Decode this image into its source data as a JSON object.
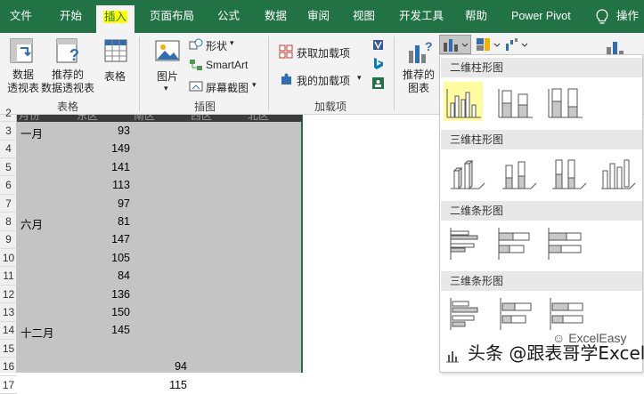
{
  "tabs": [
    {
      "label": "文件"
    },
    {
      "label": "开始"
    },
    {
      "label": "插入"
    },
    {
      "label": "页面布局"
    },
    {
      "label": "公式"
    },
    {
      "label": "数据"
    },
    {
      "label": "审阅"
    },
    {
      "label": "视图"
    },
    {
      "label": "开发工具"
    },
    {
      "label": "帮助"
    },
    {
      "label": "Power Pivot"
    },
    {
      "label": "操作"
    }
  ],
  "ribbon": {
    "pivot_table": "数据\n透视表",
    "recommended_pivot": "推荐的\n数据透视表",
    "table": "表格",
    "group_tables": "表格",
    "pictures": "图片",
    "shapes": "形状",
    "smartart": "SmartArt",
    "screenshot": "屏幕截图",
    "group_illustrations": "插图",
    "get_addins": "获取加载项",
    "my_addins": "我的加载项",
    "group_addins": "加载项",
    "recommended_charts": "推荐的\n图表"
  },
  "sheet": {
    "header_band": [
      "月份",
      "东区",
      "南区",
      "西区",
      "北区"
    ],
    "row_numbers": [
      "2",
      "3",
      "4",
      "5",
      "6",
      "7",
      "8",
      "9",
      "10",
      "11",
      "12",
      "13",
      "14",
      "15",
      "16",
      "17"
    ],
    "col_a": [
      "",
      "一月",
      "",
      "",
      "",
      "",
      "六月",
      "",
      "",
      "",
      "",
      "",
      "十二月",
      "",
      "",
      ""
    ],
    "col_b": [
      "",
      "93",
      "149",
      "141",
      "113",
      "97",
      "81",
      "147",
      "105",
      "84",
      "136",
      "150",
      "145",
      "",
      "",
      ""
    ],
    "col_d": [
      "",
      "",
      "",
      "",
      "",
      "",
      "",
      "",
      "",
      "",
      "",
      "",
      "",
      "",
      "94",
      "115"
    ]
  },
  "dropdown": {
    "sections": [
      {
        "title": "二维柱形图"
      },
      {
        "title": "三维柱形图"
      },
      {
        "title": "二维条形图"
      },
      {
        "title": "三维条形图"
      }
    ]
  },
  "watermark": {
    "text": "头条 @跟表哥学Excel",
    "sub": "ExcelEasy"
  },
  "colors": {
    "excel_green": "#217346",
    "highlight": "#ffff00"
  }
}
